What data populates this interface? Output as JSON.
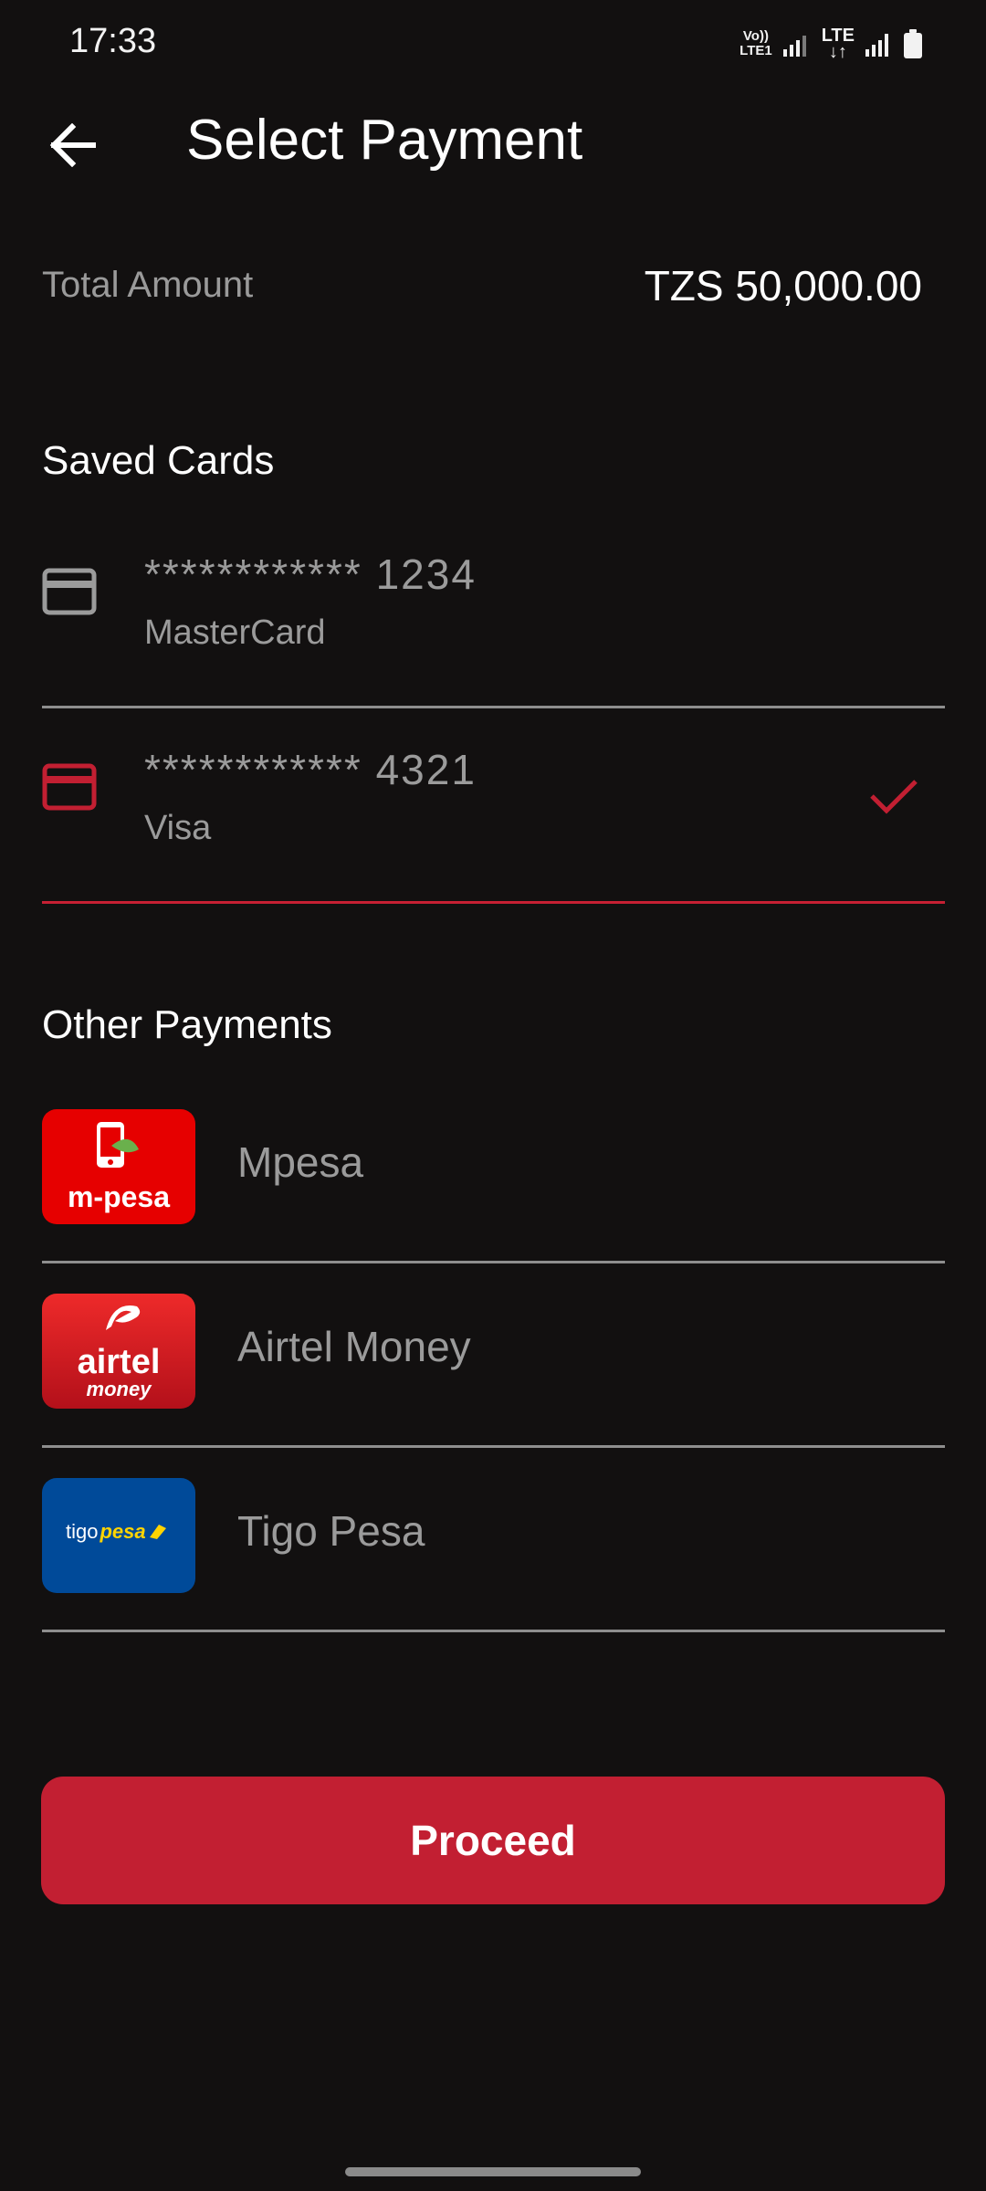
{
  "status_bar": {
    "time": "17:33",
    "volte_top": "Vo))",
    "volte_bottom": "LTE1",
    "lte_label": "LTE",
    "lte_arrows": "↓↑"
  },
  "header": {
    "title": "Select Payment",
    "back_icon": "arrow-left-icon"
  },
  "total": {
    "label": "Total Amount",
    "amount": "TZS 50,000.00"
  },
  "saved_cards": {
    "title": "Saved Cards",
    "items": [
      {
        "number": "************ 1234",
        "brand": "MasterCard",
        "selected": false
      },
      {
        "number": "************ 4321",
        "brand": "Visa",
        "selected": true
      }
    ]
  },
  "other_payments": {
    "title": "Other Payments",
    "items": [
      {
        "label": "Mpesa",
        "logo_text": "m-pesa"
      },
      {
        "label": "Airtel Money",
        "logo_text": "airtel",
        "logo_subtext": "money"
      },
      {
        "label": "Tigo Pesa",
        "logo_text": "tigo",
        "logo_subtext": "pesa"
      }
    ]
  },
  "proceed_label": "Proceed",
  "colors": {
    "background": "#121010",
    "accent": "#c21f32",
    "muted_text": "#9b9b9b",
    "divider": "#8e8e8e"
  }
}
